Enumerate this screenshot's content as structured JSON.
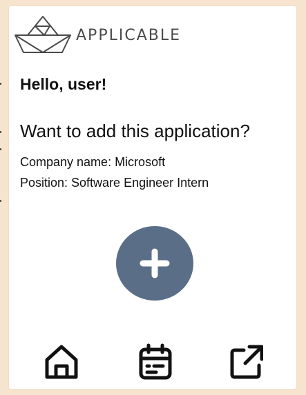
{
  "app": {
    "brand_name": "APPLICABLE"
  },
  "content": {
    "greeting": "Hello, user!",
    "question": "Want to add this application?",
    "company_line": "Company name: Microsoft",
    "position_line": "Position: Software Engineer Intern"
  },
  "actions": {
    "add_icon": "plus-icon"
  },
  "nav": [
    {
      "icon": "home-icon"
    },
    {
      "icon": "calendar-icon"
    },
    {
      "icon": "external-link-icon"
    }
  ],
  "colors": {
    "background": "#f7e4cf",
    "card": "#ffffff",
    "add_button": "#5a6e87",
    "text": "#111111",
    "brand_text": "#4a4a4a"
  }
}
